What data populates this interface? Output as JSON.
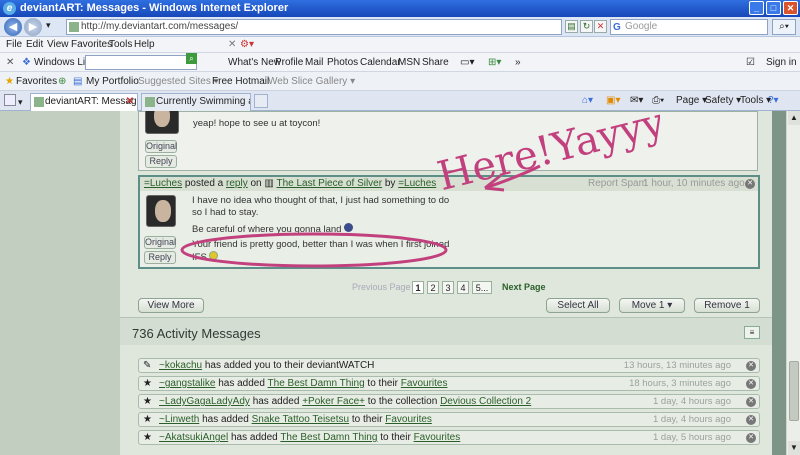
{
  "window": {
    "title": "deviantART: Messages - Windows Internet Explorer"
  },
  "address": {
    "url": "http://my.deviantart.com/messages/",
    "search_placeholder": "Google"
  },
  "menu": [
    "File",
    "Edit",
    "View",
    "Favorites",
    "Tools",
    "Help"
  ],
  "live_toolbar": {
    "brand": "Windows Live",
    "links": [
      "What's New",
      "Profile",
      "Mail",
      "Photos",
      "Calendar",
      "MSN",
      "Share"
    ],
    "signin": "Sign in"
  },
  "favorites_bar": {
    "label": "Favorites",
    "items": [
      "My Portfolio",
      "Suggested Sites ▾",
      "Free Hotmail",
      "Web Slice Gallery ▾"
    ]
  },
  "tabs": [
    {
      "label": "deviantART: Messages"
    },
    {
      "label": "Currently Swimming around i..."
    }
  ],
  "command_bar": [
    "Page ▾",
    "Safety ▾",
    "Tools ▾"
  ],
  "messages": [
    {
      "text": "yeap! hope to see u at toycon!",
      "buttons": [
        "Original",
        "Reply"
      ]
    },
    {
      "header": {
        "user": "=Luches",
        "verb1": "posted a",
        "link1": "reply",
        "verb2": "on",
        "deviation": "The Last Piece of Silver",
        "by": "by",
        "author": "=Luches",
        "report": "Report Spam",
        "time": "1 hour, 10 minutes ago"
      },
      "lines": [
        "I have no idea who thought of that, I just had something to do",
        "so I had to stay.",
        "Be careful of where you gonna land",
        "Your friend is pretty good, better than I was when I first joined",
        "IFS"
      ],
      "buttons": [
        "Original",
        "Reply"
      ]
    }
  ],
  "pagination": {
    "prev": "Previous Page",
    "pages": [
      "1",
      "2",
      "3",
      "4",
      "5..."
    ],
    "next": "Next Page"
  },
  "actions": {
    "view_more": "View More",
    "select_all": "Select All",
    "move": "Move 1",
    "remove": "Remove 1"
  },
  "annotation": "Here!Yayyy~",
  "activity": {
    "title": "736 Activity Messages",
    "rows": [
      {
        "user": "~kokachu",
        "pre": "has added you to their deviantWATCH",
        "item": "",
        "mid": "",
        "target": "",
        "time": "13 hours, 13 minutes ago"
      },
      {
        "user": "~gangstalike",
        "pre": "has added",
        "item": "The Best Damn Thing",
        "mid": "to their",
        "target": "Favourites",
        "time": "18 hours, 3 minutes ago"
      },
      {
        "user": "~LadyGagaLadyAdy",
        "pre": "has added",
        "item": "+Poker Face+",
        "mid": "to the collection",
        "target": "Devious Collection 2",
        "time": "1 day, 4 hours ago"
      },
      {
        "user": "~Linweth",
        "pre": "has added",
        "item": "Snake Tattoo Teisetsu",
        "mid": "to their",
        "target": "Favourites",
        "time": "1 day, 4 hours ago"
      },
      {
        "user": "~AkatsukiAngel",
        "pre": "has added",
        "item": "The Best Damn Thing",
        "mid": "to their",
        "target": "Favourites",
        "time": "1 day, 5 hours ago"
      }
    ]
  }
}
